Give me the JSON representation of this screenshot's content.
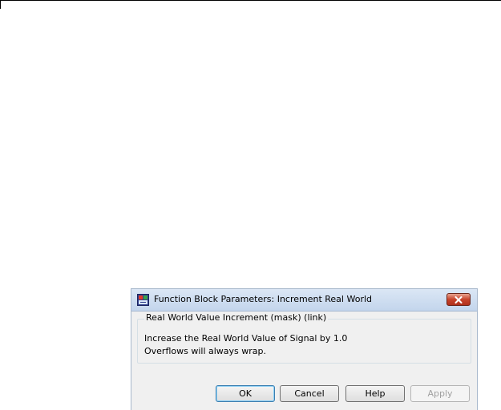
{
  "dialog": {
    "title": "Function Block Parameters: Increment Real World",
    "close_icon": "close-x-icon",
    "app_icon": "simulink-block-icon"
  },
  "group": {
    "legend": "Real World Value Increment (mask) (link)",
    "description_line_1": "Increase the Real World Value of Signal by 1.0",
    "description_line_2": "Overflows will always wrap."
  },
  "buttons": {
    "ok": "OK",
    "cancel": "Cancel",
    "help": "Help",
    "apply": "Apply"
  },
  "colors": {
    "close_button": "#c7432b",
    "dialog_background": "#f0f0f0",
    "titlebar": "#c3d5ec"
  }
}
